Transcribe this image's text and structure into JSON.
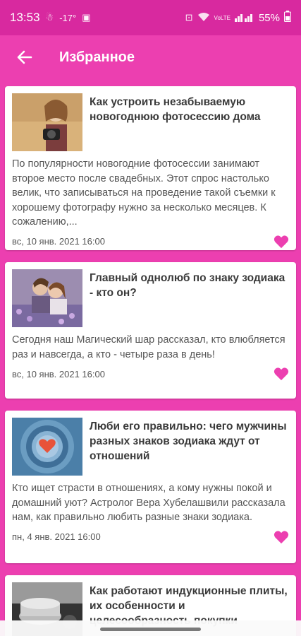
{
  "status_bar": {
    "time": "13:53",
    "temp": "-17°",
    "battery": "55%",
    "network": "VoLTE"
  },
  "app_bar": {
    "title": "Избранное"
  },
  "colors": {
    "primary": "#ec3fb0",
    "status_bar": "#d8299f",
    "heart": "#ec3fb0"
  },
  "articles": [
    {
      "title": "Как устроить незабываемую новогоднюю фотосессию дома",
      "text": "По популярности новогодние фотосессии занимают второе место после свадебных. Этот спрос настолько велик, что записываться на проведение такой съемки к хорошему фотографу нужно за несколько месяцев. К сожалению,...",
      "date": "вс, 10 янв. 2021 16:00"
    },
    {
      "title": "Главный однолюб по знаку зодиака - кто он?",
      "text": "Сегодня наш Магический шар рассказал, кто влюбляется раз и навсегда, а кто - четыре раза в день!",
      "date": "вс, 10 янв. 2021 16:00"
    },
    {
      "title": "Люби его правильно: чего мужчины разных знаков зодиака ждут от отношений",
      "text": "Кто ищет страсти в отношениях, а кому нужны покой и домашний уют? Астролог Вера Хубелашвили рассказала нам, как правильно любить разные знаки зодиака.",
      "date": "пн, 4 янв. 2021 16:00"
    },
    {
      "title": "Как работают индукционные плиты, их особенности и целесообразность покупки",
      "text": "",
      "date": ""
    }
  ]
}
